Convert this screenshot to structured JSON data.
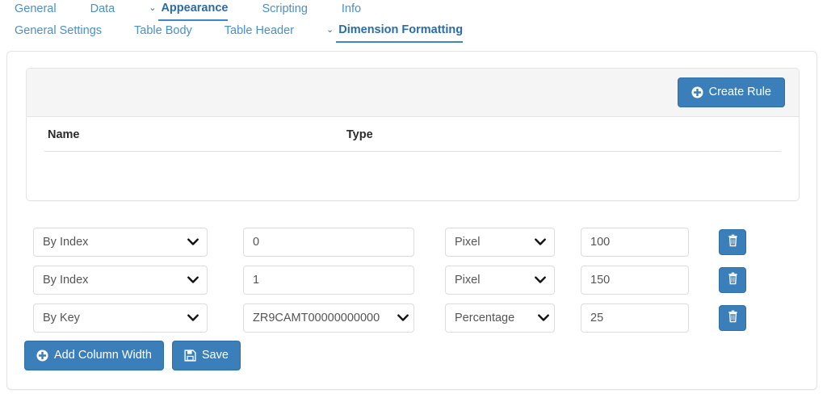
{
  "nav": {
    "primary_tabs": [
      {
        "label": "General",
        "active": false,
        "chevron": false
      },
      {
        "label": "Data",
        "active": false,
        "chevron": false
      },
      {
        "label": "Appearance",
        "active": true,
        "chevron": true
      },
      {
        "label": "Scripting",
        "active": false,
        "chevron": false
      },
      {
        "label": "Info",
        "active": false,
        "chevron": false
      }
    ],
    "secondary_tabs": [
      {
        "label": "General Settings",
        "active": false,
        "chevron": false
      },
      {
        "label": "Table Body",
        "active": false,
        "chevron": false
      },
      {
        "label": "Table Header",
        "active": false,
        "chevron": false
      },
      {
        "label": "Dimension Formatting",
        "active": true,
        "chevron": true
      }
    ],
    "chevron_glyph": "⌄"
  },
  "rules_panel": {
    "create_rule_label": "Create Rule",
    "create_rule_icon": "plus-circle-icon",
    "table": {
      "columns": [
        "Name",
        "Type"
      ],
      "rows": []
    }
  },
  "column_widths": {
    "rows": [
      {
        "mode": "By Index",
        "mode_options": [
          "By Index",
          "By Key"
        ],
        "key": "0",
        "key_is_select": false,
        "key_placeholder": "",
        "unit": "Pixel",
        "unit_options": [
          "Pixel",
          "Percentage"
        ],
        "value": "100",
        "value_placeholder": "",
        "delete_icon": "trash-icon"
      },
      {
        "mode": "By Index",
        "mode_options": [
          "By Index",
          "By Key"
        ],
        "key": "1",
        "key_is_select": false,
        "key_placeholder": "",
        "unit": "Pixel",
        "unit_options": [
          "Pixel",
          "Percentage"
        ],
        "value": "150",
        "value_placeholder": "",
        "delete_icon": "trash-icon"
      },
      {
        "mode": "By Key",
        "mode_options": [
          "By Index",
          "By Key"
        ],
        "key": "ZR9CAMT00000000000",
        "key_is_select": true,
        "key_placeholder": "",
        "unit": "Percentage",
        "unit_options": [
          "Pixel",
          "Percentage"
        ],
        "value": "25",
        "value_placeholder": "",
        "delete_icon": "trash-icon"
      }
    ]
  },
  "footer": {
    "add_column_width_label": "Add Column Width",
    "add_column_width_icon": "plus-circle-icon",
    "save_label": "Save",
    "save_icon": "floppy-save-icon"
  },
  "colors": {
    "primary_blue": "#3a7fb9",
    "primary_blue_border": "#2f6fa5",
    "link_blue": "#4a90c7",
    "active_tab_blue": "#2a6ca8",
    "panel_head_gray": "#f5f5f5",
    "border_gray": "#e4e4e4",
    "text_dark": "#2b2b2b",
    "input_text": "#555555"
  }
}
